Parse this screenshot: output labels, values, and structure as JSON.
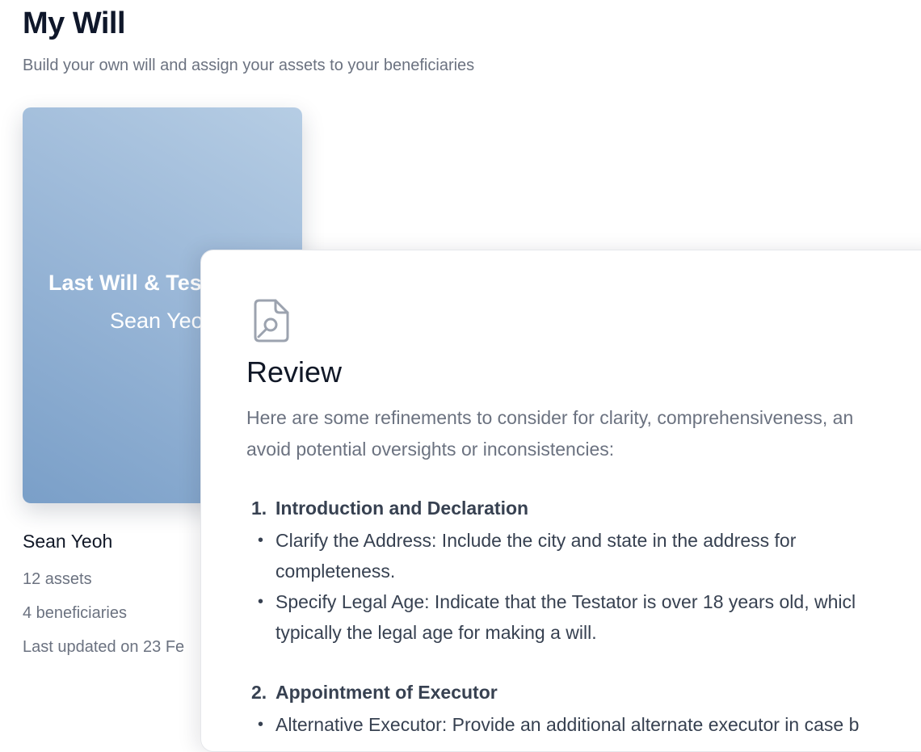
{
  "header": {
    "title": "My Will",
    "subtitle": "Build your own will and assign your assets to your beneficiaries"
  },
  "will_card": {
    "cover_title": "Last Will & Tes",
    "cover_name": "Sean Yeo",
    "owner": "Sean Yeoh",
    "assets": "12 assets",
    "beneficiaries": "4 beneficiaries",
    "last_updated": "Last updated on 23 Fe",
    "gradient_colors": [
      "#b6cde4",
      "#9bb8d8",
      "#7a9fc8"
    ]
  },
  "review": {
    "icon": "document-search-icon",
    "title": "Review",
    "intro_lines": [
      "Here are some refinements to consider for clarity, comprehensiveness, an",
      "avoid potential oversights or inconsistencies:"
    ],
    "sections": [
      {
        "number": "1.",
        "heading": "Introduction and Declaration",
        "items": [
          {
            "lines": [
              "Clarify the Address: Include the city and state in the address for",
              "completeness."
            ]
          },
          {
            "lines": [
              "Specify Legal Age: Indicate that the Testator is over 18 years old, whicl",
              "typically the legal age for making a will."
            ]
          }
        ]
      },
      {
        "number": "2.",
        "heading": "Appointment of Executor",
        "items": [
          {
            "lines": [
              "Alternative Executor: Provide an additional alternate executor in case b"
            ]
          }
        ]
      }
    ]
  }
}
